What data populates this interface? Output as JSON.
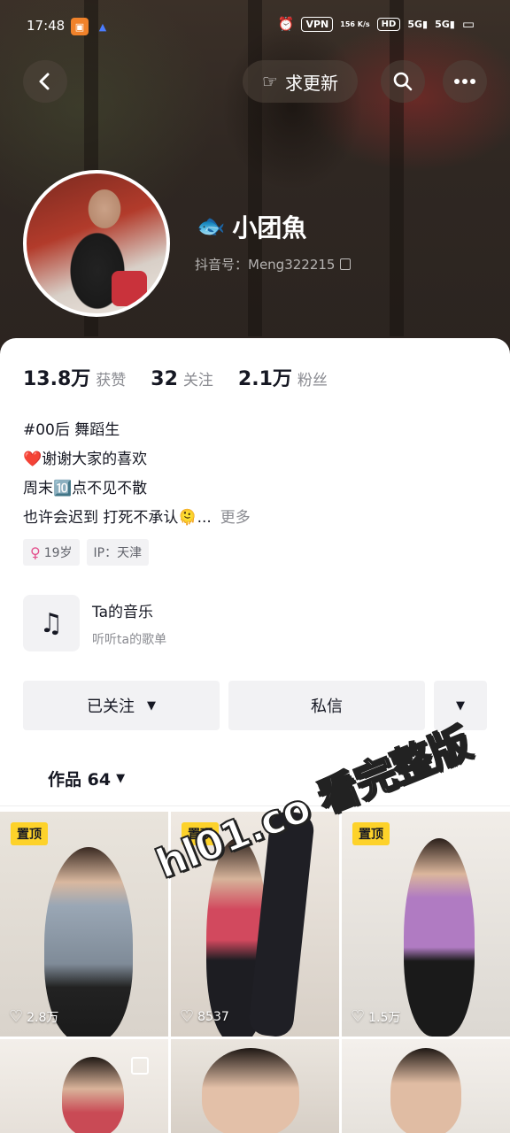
{
  "status_bar": {
    "time": "17:48",
    "vpn": "VPN",
    "net1": "5G",
    "net2": "5G",
    "hd": "HD",
    "speed": "156\nK/s"
  },
  "nav": {
    "request_update_label": "求更新"
  },
  "profile": {
    "name": "小团魚",
    "douyin_id": "抖音号：Meng322215"
  },
  "stats": [
    {
      "value": "13.8万",
      "label": "获赞"
    },
    {
      "value": "32",
      "label": "关注"
    },
    {
      "value": "2.1万",
      "label": "粉丝"
    }
  ],
  "bio": {
    "line1": "#00后 舞蹈生",
    "line2": "谢谢大家的喜欢",
    "line3": "周末🔟点不见不散",
    "line4": "也许会迟到 打死不承认🫠...",
    "more": "更多"
  },
  "tags": {
    "age": "19岁",
    "ip": "IP：天津"
  },
  "music": {
    "title": "Ta的音乐",
    "subtitle": "听听ta的歌单"
  },
  "actions": {
    "follow": "已关注",
    "message": "私信"
  },
  "works": {
    "label": "作品 64"
  },
  "videos": [
    {
      "pinned": "置顶",
      "likes": "2.8万"
    },
    {
      "pinned": "置顶",
      "likes": "8537"
    },
    {
      "pinned": "置顶",
      "likes": "1.5万"
    }
  ],
  "watermark": "hl01.co 看完整版",
  "colors": {
    "pin_badge": "#fdd22a",
    "card_bg": "#ffffff",
    "button_bg": "#f2f2f4",
    "secondary_text": "#8a8b91"
  }
}
